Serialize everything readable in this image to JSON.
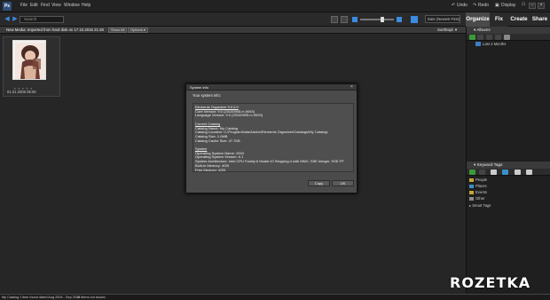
{
  "menubar": {
    "logo_text": "Ps",
    "items": [
      "File",
      "Edit",
      "Find",
      "View",
      "Window",
      "Help"
    ],
    "undo": "Undo",
    "redo": "Redo",
    "display": "Display"
  },
  "toolbar": {
    "search_placeholder": "Search",
    "sort_value": "Date (Newest First)"
  },
  "tabs": [
    "Organize",
    "Fix",
    "Create",
    "Share"
  ],
  "status_row": {
    "message": "New Media: Imported from hard disk on 17.10.2016 21:28",
    "show_all": "Show All",
    "options": "Options ▾",
    "sort_right": "Sort/Expl. ▾"
  },
  "grid": {
    "thumbnail_date": "01.01.2006 05:00",
    "stars": "★★★★★"
  },
  "albums": {
    "title": "Albums",
    "item": "Last 4 Months"
  },
  "keyword_tags": {
    "title": "Keyword Tags",
    "items": [
      {
        "label": "People",
        "color": "#c8a23a"
      },
      {
        "label": "Places",
        "color": "#3a8fc8"
      },
      {
        "label": "Events",
        "color": "#c8a23a"
      },
      {
        "label": "Other",
        "color": "#8a8a8a"
      }
    ],
    "smart_tags": "Smart Tags"
  },
  "bottom_bar": {
    "catalog": "My Catalog",
    "found": "1 item found dated Aug 2004 - Sep 2016",
    "hidden": "10 items not shown"
  },
  "dialog": {
    "title": "System Info",
    "prompt": "Your system info:",
    "close": "×",
    "lines": [
      {
        "text": "Elements Organizer 9.0.0.0",
        "heading": true
      },
      {
        "text": "Core Version: 9.0 (20100905.m.9093)",
        "heading": false
      },
      {
        "text": "Language Version: 9.0 (20100905.m.9093)",
        "heading": false
      },
      {
        "text": "",
        "heading": false
      },
      {
        "text": "Current Catalog",
        "heading": true
      },
      {
        "text": "Catalog Name: My Catalog",
        "heading": false
      },
      {
        "text": "Catalog Location: C:\\ProgramData\\Adobe\\Elements Organizer\\Catalogs\\My Catalog\\",
        "heading": false
      },
      {
        "text": "Catalog Size: 1.0MB",
        "heading": false
      },
      {
        "text": "Catalog Cache Size: 47.7KB",
        "heading": false
      },
      {
        "text": "",
        "heading": false
      },
      {
        "text": "System",
        "heading": true
      },
      {
        "text": "Operating System Name: 2000",
        "heading": false
      },
      {
        "text": "Operating System Version: 6.1",
        "heading": false
      },
      {
        "text": "System Architecture: Intel CPU Family:6 Model:10 Stepping:4 with MMX, SSE Integer, SSE FP",
        "heading": false
      },
      {
        "text": "Built-in Memory: 4GB",
        "heading": false
      },
      {
        "text": "Free Memory: 4GB",
        "heading": false
      }
    ],
    "copy_button": "Copy",
    "ok_button": "OK"
  },
  "watermark": "ROZETKA"
}
